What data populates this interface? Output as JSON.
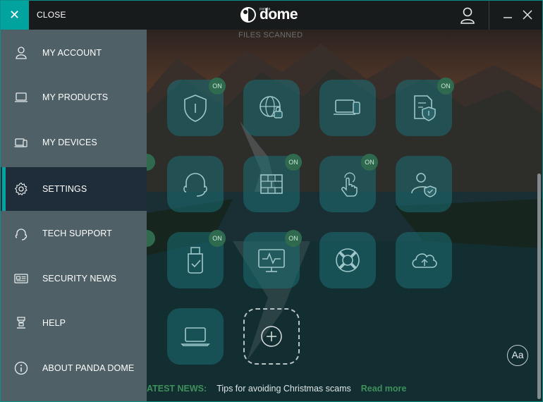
{
  "titlebar": {
    "close_icon": "close-icon",
    "close_label": "CLOSE",
    "brand": "dome",
    "brand_sub": "panda",
    "user_icon": "user-icon",
    "minimize_icon": "minimize-icon",
    "window_close_icon": "window-close-icon",
    "accent_color": "#00a39e"
  },
  "status": {
    "files_scanned": "FILES SCANNED"
  },
  "menu": {
    "items": [
      {
        "label": "MY ACCOUNT",
        "icon": "user-icon"
      },
      {
        "label": "MY PRODUCTS",
        "icon": "laptop-icon"
      },
      {
        "label": "MY DEVICES",
        "icon": "devices-icon"
      },
      {
        "label": "SETTINGS",
        "icon": "gear-icon",
        "active": true
      },
      {
        "label": "TECH SUPPORT",
        "icon": "headset-icon"
      },
      {
        "label": "SECURITY NEWS",
        "icon": "news-icon"
      },
      {
        "label": "HELP",
        "icon": "help-icon"
      },
      {
        "label": "ABOUT PANDA DOME",
        "icon": "info-icon"
      }
    ]
  },
  "tiles": [
    {
      "icon": "shield-icon",
      "badge": "ON"
    },
    {
      "icon": "web-lock-icon",
      "badge": ""
    },
    {
      "icon": "devices-icon",
      "badge": ""
    },
    {
      "icon": "document-shield-icon",
      "badge": "ON"
    },
    {
      "icon": "headset-icon",
      "badge": ""
    },
    {
      "icon": "firewall-icon",
      "badge": "ON"
    },
    {
      "icon": "touch-icon",
      "badge": "ON"
    },
    {
      "icon": "user-shield-icon",
      "badge": ""
    },
    {
      "icon": "usb-check-icon",
      "badge": "ON"
    },
    {
      "icon": "monitor-pulse-icon",
      "badge": "ON"
    },
    {
      "icon": "lifebuoy-icon",
      "badge": ""
    },
    {
      "icon": "cloud-upload-icon",
      "badge": ""
    },
    {
      "icon": "laptop-icon",
      "badge": ""
    }
  ],
  "add_tile_icon": "add-circle-icon",
  "font_size_button": "Aa",
  "news": {
    "label": "ATEST NEWS:",
    "headline": "Tips for avoiding Christmas scams",
    "link": "Read more"
  }
}
